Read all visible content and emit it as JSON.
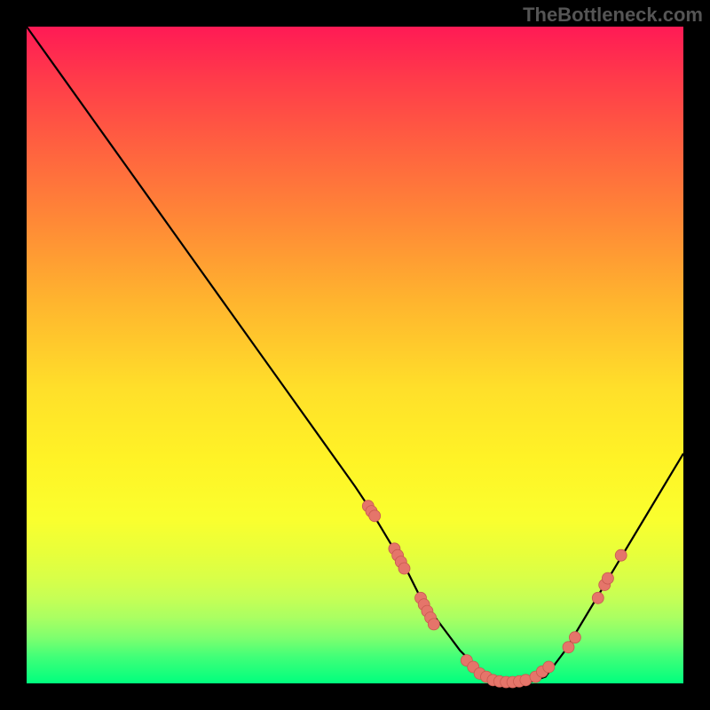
{
  "watermark": "TheBottleneck.com",
  "chart_data": {
    "type": "line",
    "title": "",
    "xlabel": "",
    "ylabel": "",
    "xlim": [
      0,
      100
    ],
    "ylim": [
      0,
      100
    ],
    "series": [
      {
        "name": "curve",
        "x": [
          0,
          5,
          10,
          15,
          20,
          25,
          30,
          35,
          40,
          45,
          50,
          52,
          55,
          58,
          60,
          63,
          66,
          70,
          73,
          76,
          79,
          82,
          85,
          88,
          91,
          94,
          97,
          100
        ],
        "y": [
          100,
          93,
          86,
          79,
          72,
          65,
          58,
          51,
          44,
          37,
          30,
          27,
          22,
          17,
          13,
          9,
          5,
          1,
          0,
          0,
          1,
          5,
          10,
          15,
          20,
          25,
          30,
          35
        ]
      }
    ],
    "markers": [
      {
        "x": 52.0,
        "y": 27.0
      },
      {
        "x": 52.5,
        "y": 26.2
      },
      {
        "x": 53.0,
        "y": 25.5
      },
      {
        "x": 56.0,
        "y": 20.5
      },
      {
        "x": 56.5,
        "y": 19.5
      },
      {
        "x": 57.0,
        "y": 18.5
      },
      {
        "x": 57.5,
        "y": 17.5
      },
      {
        "x": 60.0,
        "y": 13.0
      },
      {
        "x": 60.5,
        "y": 12.0
      },
      {
        "x": 61.0,
        "y": 11.0
      },
      {
        "x": 61.5,
        "y": 10.0
      },
      {
        "x": 62.0,
        "y": 9.0
      },
      {
        "x": 67.0,
        "y": 3.5
      },
      {
        "x": 68.0,
        "y": 2.5
      },
      {
        "x": 69.0,
        "y": 1.5
      },
      {
        "x": 70.0,
        "y": 1.0
      },
      {
        "x": 71.0,
        "y": 0.5
      },
      {
        "x": 72.0,
        "y": 0.3
      },
      {
        "x": 73.0,
        "y": 0.2
      },
      {
        "x": 74.0,
        "y": 0.2
      },
      {
        "x": 75.0,
        "y": 0.3
      },
      {
        "x": 76.0,
        "y": 0.5
      },
      {
        "x": 77.5,
        "y": 1.0
      },
      {
        "x": 78.5,
        "y": 1.8
      },
      {
        "x": 79.5,
        "y": 2.5
      },
      {
        "x": 82.5,
        "y": 5.5
      },
      {
        "x": 83.5,
        "y": 7.0
      },
      {
        "x": 87.0,
        "y": 13.0
      },
      {
        "x": 88.0,
        "y": 15.0
      },
      {
        "x": 88.5,
        "y": 16.0
      },
      {
        "x": 90.5,
        "y": 19.5
      }
    ],
    "gradient_stops": [
      {
        "pos": 0,
        "color": "#ff1a55"
      },
      {
        "pos": 8,
        "color": "#ff3b4a"
      },
      {
        "pos": 18,
        "color": "#ff6040"
      },
      {
        "pos": 30,
        "color": "#ff8a36"
      },
      {
        "pos": 42,
        "color": "#ffb52e"
      },
      {
        "pos": 55,
        "color": "#ffdf2a"
      },
      {
        "pos": 66,
        "color": "#fff326"
      },
      {
        "pos": 75,
        "color": "#faff2e"
      },
      {
        "pos": 80,
        "color": "#e8ff3a"
      },
      {
        "pos": 84,
        "color": "#d8ff48"
      },
      {
        "pos": 87,
        "color": "#c6ff55"
      },
      {
        "pos": 90,
        "color": "#aaff62"
      },
      {
        "pos": 93,
        "color": "#7fff6e"
      },
      {
        "pos": 96,
        "color": "#40ff78"
      },
      {
        "pos": 100,
        "color": "#00ff7e"
      }
    ],
    "colors": {
      "curve": "#000000",
      "marker_fill": "#e5756a",
      "marker_stroke": "#c85a50",
      "background": "#000000"
    }
  }
}
